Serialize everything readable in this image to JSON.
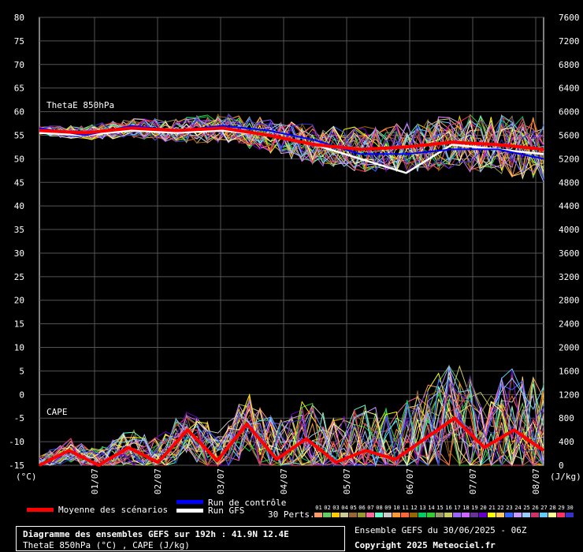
{
  "chart_data": [
    {
      "type": "line",
      "title": "ThetaE 850hPa",
      "y_left_unit": "(°C)",
      "ylim": [
        -15,
        80
      ],
      "y_ticks": [
        80,
        75,
        70,
        65,
        60,
        55,
        50,
        45,
        40,
        35,
        30,
        25,
        20,
        15,
        10,
        5,
        0,
        -5,
        -10,
        -15
      ],
      "x": [
        "01/07",
        "02/07",
        "03/07",
        "04/07",
        "05/07",
        "06/07",
        "07/07",
        "08/07"
      ],
      "series": [
        {
          "name": "Moyenne des scénarios",
          "color": "#ff0000",
          "values": [
            56,
            55.5,
            56.5,
            56,
            56.5,
            55,
            53,
            52,
            52.5,
            53.5,
            53,
            52
          ]
        },
        {
          "name": "Run de contrôle",
          "color": "#0000ff",
          "values": [
            56.5,
            55,
            57,
            56,
            57,
            56,
            54,
            51,
            51,
            52,
            52,
            50
          ]
        },
        {
          "name": "Run GFS",
          "color": "#ffffff",
          "values": [
            55.5,
            55,
            56,
            55.5,
            56,
            55,
            53,
            50,
            47,
            53,
            52,
            51
          ]
        }
      ]
    },
    {
      "type": "line",
      "title": "CAPE",
      "y_right_unit": "(J/kg)",
      "ylim": [
        0,
        7600
      ],
      "y_ticks": [
        7600,
        7200,
        6800,
        6400,
        6000,
        5600,
        5200,
        4800,
        4400,
        4000,
        3600,
        3200,
        2800,
        2400,
        2000,
        1600,
        1200,
        800,
        400,
        0
      ],
      "x": [
        "01/07",
        "02/07",
        "03/07",
        "04/07",
        "05/07",
        "06/07",
        "07/07",
        "08/07"
      ],
      "series": [
        {
          "name": "Moyenne des scénarios",
          "color": "#ff0000",
          "values": [
            0,
            250,
            0,
            300,
            50,
            600,
            80,
            700,
            100,
            450,
            50,
            250,
            100,
            450,
            800,
            300,
            600,
            250
          ]
        }
      ]
    }
  ],
  "legend": {
    "mean_label": "Moyenne des scénarios",
    "control_label": "Run de contrôle",
    "gfs_label": "Run GFS",
    "perts_label": "30 Perts.",
    "pert_numbers": [
      "01",
      "02",
      "03",
      "04",
      "05",
      "06",
      "07",
      "08",
      "09",
      "10",
      "11",
      "12",
      "13",
      "14",
      "15",
      "16",
      "17",
      "18",
      "19",
      "20",
      "21",
      "22",
      "23",
      "24",
      "25",
      "26",
      "27",
      "28",
      "29",
      "30"
    ],
    "pert_colors": [
      "#ff9966",
      "#66cc66",
      "#ffcc00",
      "#cccc99",
      "#996633",
      "#999933",
      "#ff6699",
      "#66ffcc",
      "#cccccc",
      "#ff9933",
      "#ff6633",
      "#996600",
      "#00cc66",
      "#33cc33",
      "#999966",
      "#cccc66",
      "#9966ff",
      "#cc66ff",
      "#663399",
      "#6600cc",
      "#ffff00",
      "#ffcc66",
      "#3366ff",
      "#cc99ff",
      "#99ccff",
      "#cc3366",
      "#66ccff",
      "#ffff99",
      "#ff3366",
      "#3333cc"
    ]
  },
  "footer": {
    "title": "Diagramme des ensembles GEFS sur 192h : 41.9N 12.4E",
    "subtitle": "ThetaE 850hPa (°C) , CAPE (J/kg)",
    "run_info": "Ensemble GEFS du 30/06/2025 - 06Z",
    "copyright": "Copyright 2025 Meteociel.fr"
  }
}
